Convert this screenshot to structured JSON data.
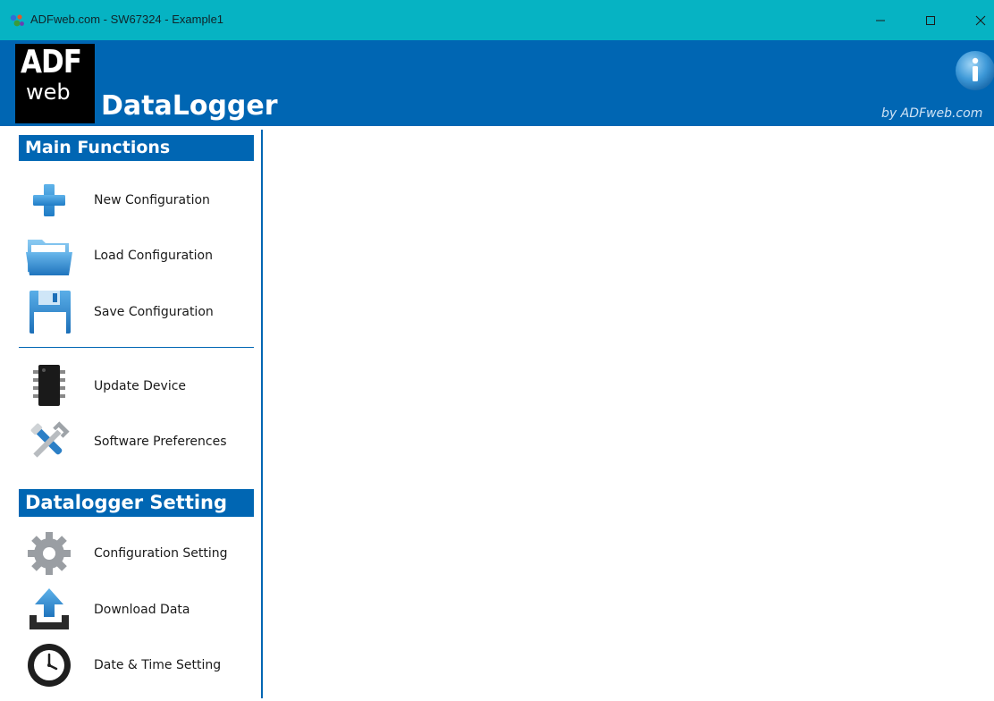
{
  "window": {
    "title": "ADFweb.com - SW67324 - Example1"
  },
  "banner": {
    "logo_top": "ADF",
    "logo_bottom": "web",
    "product": "DataLogger",
    "byline": "by ADFweb.com"
  },
  "sidebar": {
    "main_header": "Main Functions",
    "main_items": [
      {
        "label": "New Configuration",
        "icon": "plus-icon"
      },
      {
        "label": "Load Configuration",
        "icon": "folder-icon"
      },
      {
        "label": "Save Configuration",
        "icon": "floppy-disk-icon"
      }
    ],
    "tool_items": [
      {
        "label": "Update Device",
        "icon": "chip-icon"
      },
      {
        "label": "Software Preferences",
        "icon": "tools-icon"
      }
    ],
    "datalogger_header": "Datalogger Setting",
    "datalogger_items": [
      {
        "label": "Configuration Setting",
        "icon": "gear-icon"
      },
      {
        "label": "Download Data",
        "icon": "download-icon"
      },
      {
        "label": "Date & Time Setting",
        "icon": "clock-icon"
      }
    ]
  },
  "colors": {
    "titlebar": "#06b3c3",
    "brand_blue": "#0066b3"
  }
}
